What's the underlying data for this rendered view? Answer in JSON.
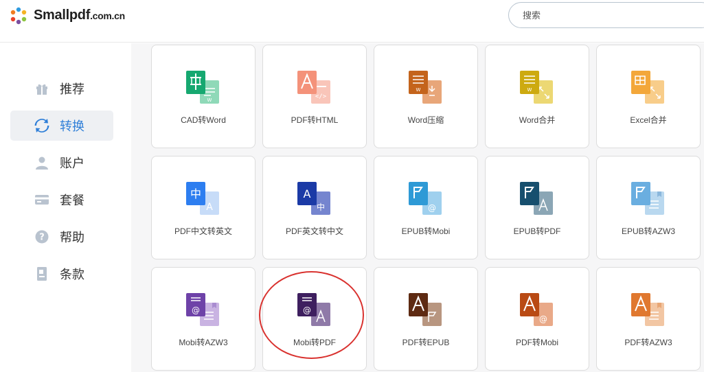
{
  "header": {
    "brand_main": "Smallpdf",
    "brand_suffix": ".com.cn",
    "search_placeholder": "搜索"
  },
  "sidebar": {
    "items": [
      {
        "label": "推荐",
        "icon": "gift-icon",
        "active": false
      },
      {
        "label": "转换",
        "icon": "sync-icon",
        "active": true
      },
      {
        "label": "账户",
        "icon": "user-icon",
        "active": false
      },
      {
        "label": "套餐",
        "icon": "card-icon",
        "active": false
      },
      {
        "label": "帮助",
        "icon": "help-icon",
        "active": false
      },
      {
        "label": "条款",
        "icon": "document-icon",
        "active": false
      }
    ]
  },
  "tools": [
    {
      "label": "CAD转Word",
      "icon": "cad-to-word-icon"
    },
    {
      "label": "PDF转HTML",
      "icon": "pdf-to-html-icon"
    },
    {
      "label": "Word压缩",
      "icon": "word-compress-icon"
    },
    {
      "label": "Word合并",
      "icon": "word-merge-icon"
    },
    {
      "label": "Excel合并",
      "icon": "excel-merge-icon"
    },
    {
      "label": "PDF中文转英文",
      "icon": "translate-cn-en-icon"
    },
    {
      "label": "PDF英文转中文",
      "icon": "translate-en-cn-icon"
    },
    {
      "label": "EPUB转Mobi",
      "icon": "epub-to-mobi-icon"
    },
    {
      "label": "EPUB转PDF",
      "icon": "epub-to-pdf-icon"
    },
    {
      "label": "EPUB转AZW3",
      "icon": "epub-to-azw3-icon"
    },
    {
      "label": "Mobi转AZW3",
      "icon": "mobi-to-azw3-icon"
    },
    {
      "label": "Mobi转PDF",
      "icon": "mobi-to-pdf-icon",
      "highlighted": true
    },
    {
      "label": "PDF转EPUB",
      "icon": "pdf-to-epub-icon"
    },
    {
      "label": "PDF转Mobi",
      "icon": "pdf-to-mobi-icon"
    },
    {
      "label": "PDF转AZW3",
      "icon": "pdf-to-azw3-icon"
    }
  ],
  "colors": {
    "accent": "#2f7fd8",
    "highlight_circle": "#d9322f"
  }
}
